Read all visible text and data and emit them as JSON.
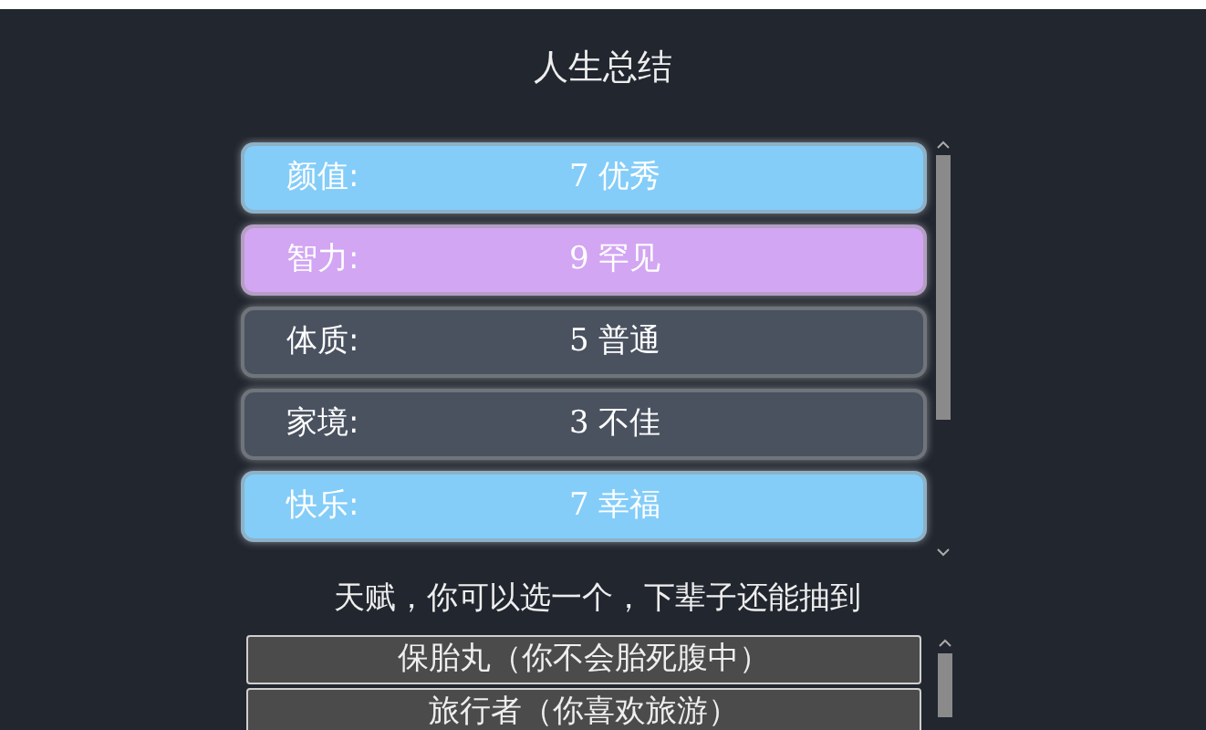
{
  "title": "人生总结",
  "stats": [
    {
      "label": "颜值:",
      "value": "7 优秀",
      "color": "#84cdf9"
    },
    {
      "label": "智力:",
      "value": "9 罕见",
      "color": "#d2a6f3"
    },
    {
      "label": "体质:",
      "value": "5 普通",
      "color": "#4a5260"
    },
    {
      "label": "家境:",
      "value": "3 不佳",
      "color": "#4a5260"
    },
    {
      "label": "快乐:",
      "value": "7 幸福",
      "color": "#84cdf9"
    }
  ],
  "talent_prompt": "天赋，你可以选一个，下辈子还能抽到",
  "talents": [
    {
      "label": "保胎丸（你不会胎死腹中）"
    },
    {
      "label": "旅行者（你喜欢旅游）"
    }
  ]
}
